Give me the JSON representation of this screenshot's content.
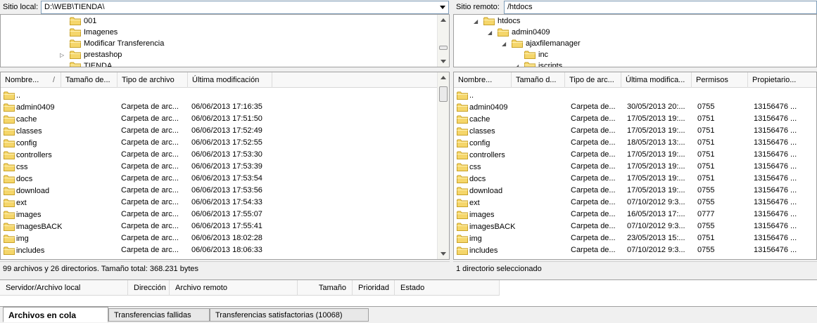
{
  "local": {
    "label": "Sitio local:",
    "path": "D:\\WEB\\TIENDA\\",
    "tree": [
      {
        "name": "001",
        "expander": ""
      },
      {
        "name": "Imagenes",
        "expander": ""
      },
      {
        "name": "Modificar Transferencia",
        "expander": ""
      },
      {
        "name": "prestashop",
        "expander": "▷"
      },
      {
        "name": "TIENDA",
        "expander": ""
      }
    ],
    "columns": [
      "Nombre...",
      "Tamaño de...",
      "Tipo de archivo",
      "Última modificación"
    ],
    "sort_indicator": "/",
    "rows": [
      {
        "name": "..",
        "size": "",
        "type": "",
        "modified": ""
      },
      {
        "name": "admin0409",
        "size": "",
        "type": "Carpeta de arc...",
        "modified": "06/06/2013 17:16:35"
      },
      {
        "name": "cache",
        "size": "",
        "type": "Carpeta de arc...",
        "modified": "06/06/2013 17:51:50"
      },
      {
        "name": "classes",
        "size": "",
        "type": "Carpeta de arc...",
        "modified": "06/06/2013 17:52:49"
      },
      {
        "name": "config",
        "size": "",
        "type": "Carpeta de arc...",
        "modified": "06/06/2013 17:52:55"
      },
      {
        "name": "controllers",
        "size": "",
        "type": "Carpeta de arc...",
        "modified": "06/06/2013 17:53:30"
      },
      {
        "name": "css",
        "size": "",
        "type": "Carpeta de arc...",
        "modified": "06/06/2013 17:53:39"
      },
      {
        "name": "docs",
        "size": "",
        "type": "Carpeta de arc...",
        "modified": "06/06/2013 17:53:54"
      },
      {
        "name": "download",
        "size": "",
        "type": "Carpeta de arc...",
        "modified": "06/06/2013 17:53:56"
      },
      {
        "name": "ext",
        "size": "",
        "type": "Carpeta de arc...",
        "modified": "06/06/2013 17:54:33"
      },
      {
        "name": "images",
        "size": "",
        "type": "Carpeta de arc...",
        "modified": "06/06/2013 17:55:07"
      },
      {
        "name": "imagesBACK",
        "size": "",
        "type": "Carpeta de arc...",
        "modified": "06/06/2013 17:55:41"
      },
      {
        "name": "img",
        "size": "",
        "type": "Carpeta de arc...",
        "modified": "06/06/2013 18:02:28"
      },
      {
        "name": "includes",
        "size": "",
        "type": "Carpeta de arc...",
        "modified": "06/06/2013 18:06:33"
      }
    ],
    "status": "99 archivos y 26 directorios. Tamaño total: 368.231 bytes"
  },
  "remote": {
    "label": "Sitio remoto:",
    "path": "/htdocs",
    "tree": [
      {
        "name": "htdocs",
        "expander": "◢"
      },
      {
        "name": "admin0409",
        "expander": "◢"
      },
      {
        "name": "ajaxfilemanager",
        "expander": "◢"
      },
      {
        "name": "inc",
        "expander": ""
      },
      {
        "name": "jscripts",
        "expander": "◢"
      }
    ],
    "columns": [
      "Nombre...",
      "Tamaño d...",
      "Tipo de arc...",
      "Última modifica...",
      "Permisos",
      "Propietario..."
    ],
    "sort_indicator": "",
    "rows": [
      {
        "name": "..",
        "size": "",
        "type": "",
        "modified": "",
        "perm": "",
        "owner": ""
      },
      {
        "name": "admin0409",
        "size": "",
        "type": "Carpeta de...",
        "modified": "30/05/2013 20:...",
        "perm": "0755",
        "owner": "13156476 ..."
      },
      {
        "name": "cache",
        "size": "",
        "type": "Carpeta de...",
        "modified": "17/05/2013 19:...",
        "perm": "0751",
        "owner": "13156476 ..."
      },
      {
        "name": "classes",
        "size": "",
        "type": "Carpeta de...",
        "modified": "17/05/2013 19:...",
        "perm": "0751",
        "owner": "13156476 ..."
      },
      {
        "name": "config",
        "size": "",
        "type": "Carpeta de...",
        "modified": "18/05/2013 13:...",
        "perm": "0751",
        "owner": "13156476 ..."
      },
      {
        "name": "controllers",
        "size": "",
        "type": "Carpeta de...",
        "modified": "17/05/2013 19:...",
        "perm": "0751",
        "owner": "13156476 ..."
      },
      {
        "name": "css",
        "size": "",
        "type": "Carpeta de...",
        "modified": "17/05/2013 19:...",
        "perm": "0751",
        "owner": "13156476 ..."
      },
      {
        "name": "docs",
        "size": "",
        "type": "Carpeta de...",
        "modified": "17/05/2013 19:...",
        "perm": "0751",
        "owner": "13156476 ..."
      },
      {
        "name": "download",
        "size": "",
        "type": "Carpeta de...",
        "modified": "17/05/2013 19:...",
        "perm": "0755",
        "owner": "13156476 ..."
      },
      {
        "name": "ext",
        "size": "",
        "type": "Carpeta de...",
        "modified": "07/10/2012 9:3...",
        "perm": "0755",
        "owner": "13156476 ..."
      },
      {
        "name": "images",
        "size": "",
        "type": "Carpeta de...",
        "modified": "16/05/2013 17:...",
        "perm": "0777",
        "owner": "13156476 ..."
      },
      {
        "name": "imagesBACK",
        "size": "",
        "type": "Carpeta de...",
        "modified": "07/10/2012 9:3...",
        "perm": "0755",
        "owner": "13156476 ..."
      },
      {
        "name": "img",
        "size": "",
        "type": "Carpeta de...",
        "modified": "23/05/2013 15:...",
        "perm": "0751",
        "owner": "13156476 ..."
      },
      {
        "name": "includes",
        "size": "",
        "type": "Carpeta de...",
        "modified": "07/10/2012 9:3...",
        "perm": "0755",
        "owner": "13156476 ..."
      }
    ],
    "status": "1 directorio seleccionado"
  },
  "queue": {
    "columns": [
      "Servidor/Archivo local",
      "Dirección",
      "Archivo remoto",
      "Tamaño",
      "Prioridad",
      "Estado"
    ]
  },
  "tabs": [
    "Archivos en cola",
    "Transferencias fallidas",
    "Transferencias satisfactorias (10068)"
  ],
  "colors": {
    "folder": "#f5d66b",
    "folder_edge": "#c9a227",
    "border": "#a0a0a0",
    "combo_border": "#7f9db9"
  },
  "icons": {
    "folder": "folder-icon",
    "dropdown": "chevron-down-icon"
  }
}
